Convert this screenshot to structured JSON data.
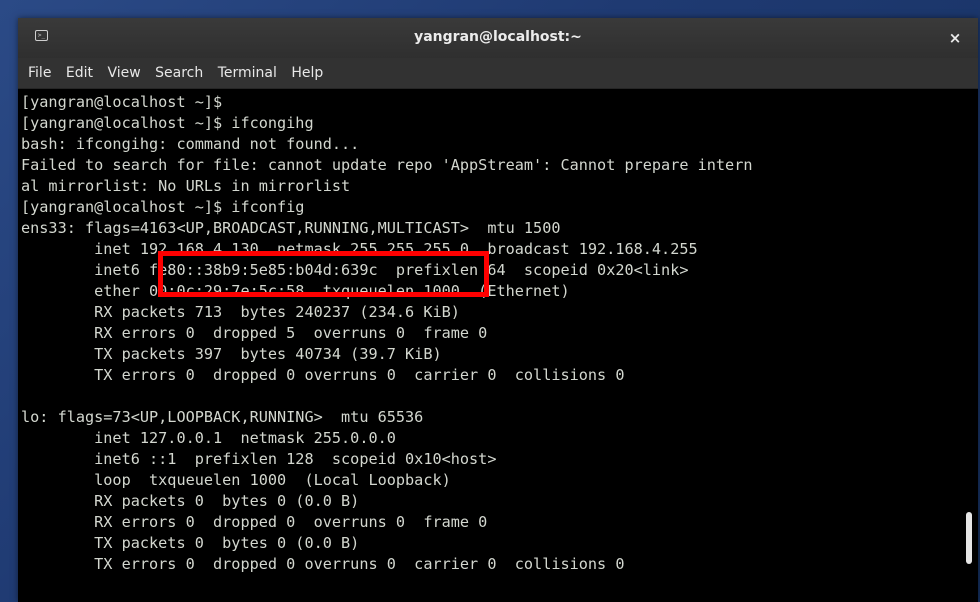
{
  "window": {
    "title": "yangran@localhost:~",
    "close_label": "×",
    "icon": "terminal-icon"
  },
  "menu": [
    "File",
    "Edit",
    "View",
    "Search",
    "Terminal",
    "Help"
  ],
  "terminal": {
    "lines": [
      "[yangran@localhost ~]$",
      "[yangran@localhost ~]$ ifcongihg",
      "bash: ifcongihg: command not found...",
      "Failed to search for file: cannot update repo 'AppStream': Cannot prepare intern",
      "al mirrorlist: No URLs in mirrorlist",
      "[yangran@localhost ~]$ ifconfig",
      "ens33: flags=4163<UP,BROADCAST,RUNNING,MULTICAST>  mtu 1500",
      "        inet 192.168.4.130  netmask 255.255.255.0  broadcast 192.168.4.255",
      "        inet6 fe80::38b9:5e85:b04d:639c  prefixlen 64  scopeid 0x20<link>",
      "        ether 00:0c:29:7e:5c:58  txqueuelen 1000  (Ethernet)",
      "        RX packets 713  bytes 240237 (234.6 KiB)",
      "        RX errors 0  dropped 5  overruns 0  frame 0",
      "        TX packets 397  bytes 40734 (39.7 KiB)",
      "        TX errors 0  dropped 0 overruns 0  carrier 0  collisions 0",
      "",
      "lo: flags=73<UP,LOOPBACK,RUNNING>  mtu 65536",
      "        inet 127.0.0.1  netmask 255.0.0.0",
      "        inet6 ::1  prefixlen 128  scopeid 0x10<host>",
      "        loop  txqueuelen 1000  (Local Loopback)",
      "        RX packets 0  bytes 0 (0.0 B)",
      "        RX errors 0  dropped 0  overruns 0  frame 0",
      "        TX packets 0  bytes 0 (0.0 B)",
      "        TX errors 0  dropped 0 overruns 0  carrier 0  collisions 0"
    ]
  },
  "annotation": {
    "color": "#ff0000"
  }
}
